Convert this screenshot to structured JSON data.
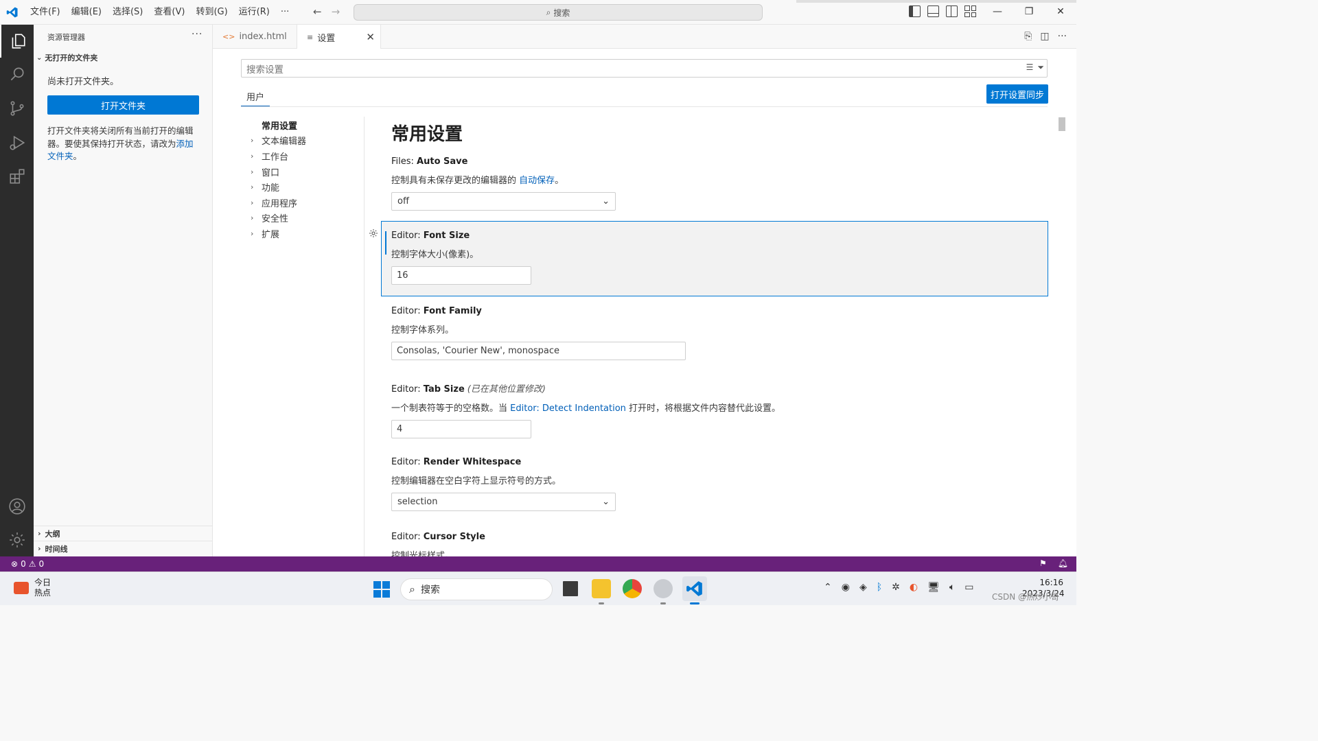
{
  "titlebar": {
    "menus": [
      "文件(F)",
      "编辑(E)",
      "选择(S)",
      "查看(V)",
      "转到(G)",
      "运行(R)",
      "···"
    ],
    "search_label": "搜索"
  },
  "sidebar": {
    "title": "资源管理器",
    "more": "···",
    "section": "无打开的文件夹",
    "empty_text": "尚未打开文件夹。",
    "open_button": "打开文件夹",
    "desc_text": "打开文件夹将关闭所有当前打开的编辑器。要使其保持打开状态，请改为",
    "desc_link": "添加文件夹",
    "desc_end": "。",
    "outline_label": "大纲",
    "timeline_label": "时间线"
  },
  "tabs": [
    {
      "label": "index.html"
    },
    {
      "label": "设置"
    }
  ],
  "settings": {
    "search_placeholder": "搜索设置",
    "scope_tab": "用户",
    "sync_button": "打开设置同步",
    "toc": [
      "常用设置",
      "文本编辑器",
      "工作台",
      "窗口",
      "功能",
      "应用程序",
      "安全性",
      "扩展"
    ],
    "page_title": "常用设置",
    "items": [
      {
        "prefix": "Files: ",
        "name": "Auto Save",
        "desc": "控制具有未保存更改的编辑器的 ",
        "desc_link": "自动保存",
        "desc_end": "。",
        "value": "off"
      },
      {
        "prefix": "Editor: ",
        "name": "Font Size",
        "desc": "控制字体大小(像素)。",
        "value": "16"
      },
      {
        "prefix": "Editor: ",
        "name": "Font Family",
        "desc": "控制字体系列。",
        "value": "Consolas, 'Courier New', monospace"
      },
      {
        "prefix": "Editor: ",
        "name": "Tab Size",
        "modified": "(已在其他位置修改)",
        "desc": "一个制表符等于的空格数。当 ",
        "desc_link": "Editor: Detect Indentation",
        "desc_end": " 打开时，将根据文件内容替代此设置。",
        "value": "4"
      },
      {
        "prefix": "Editor: ",
        "name": "Render Whitespace",
        "desc": "控制编辑器在空白字符上显示符号的方式。",
        "value": "selection"
      },
      {
        "prefix": "Editor: ",
        "name": "Cursor Style",
        "desc": "控制光标样式。"
      }
    ]
  },
  "statusbar": {
    "errors": "0",
    "warnings": "0"
  },
  "taskbar": {
    "weather_line1": "今日",
    "weather_line2": "热点",
    "search_label": "搜索",
    "time": "16:16",
    "date": "2023/3/24",
    "watermark": "CSDN @热炒小哥"
  },
  "colors": {
    "accent": "#0078d4",
    "statusbar": "#68217a",
    "activitybar": "#2c2c2c",
    "link": "#005fb8"
  }
}
